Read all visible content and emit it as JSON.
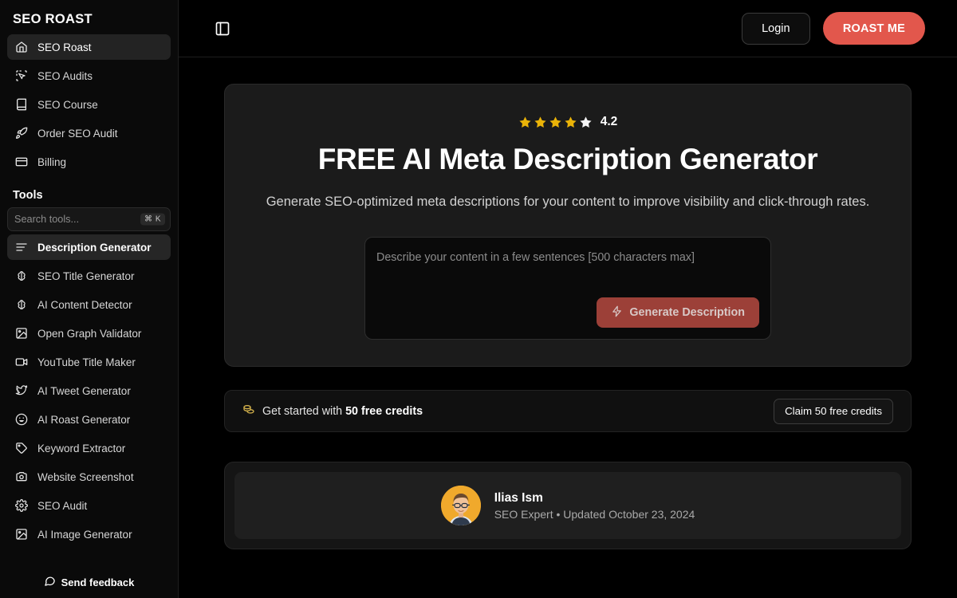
{
  "sidebar": {
    "brand": "SEO ROAST",
    "nav": [
      {
        "label": "SEO Roast",
        "icon": "home-icon",
        "active": true
      },
      {
        "label": "SEO Audits",
        "icon": "cursor-icon",
        "active": false
      },
      {
        "label": "SEO Course",
        "icon": "book-icon",
        "active": false
      },
      {
        "label": "Order SEO Audit",
        "icon": "rocket-icon",
        "active": false
      },
      {
        "label": "Billing",
        "icon": "card-icon",
        "active": false
      }
    ],
    "tools_label": "Tools",
    "search": {
      "placeholder": "Search tools...",
      "value": "",
      "shortcut": "⌘ K"
    },
    "tools": [
      {
        "label": "Description Generator",
        "icon": "lines-icon",
        "active": true
      },
      {
        "label": "SEO Title Generator",
        "icon": "brain-icon",
        "active": false
      },
      {
        "label": "AI Content Detector",
        "icon": "brain-icon",
        "active": false
      },
      {
        "label": "Open Graph Validator",
        "icon": "image-icon",
        "active": false
      },
      {
        "label": "YouTube Title Maker",
        "icon": "video-icon",
        "active": false
      },
      {
        "label": "AI Tweet Generator",
        "icon": "twitter-icon",
        "active": false
      },
      {
        "label": "AI Roast Generator",
        "icon": "smile-icon",
        "active": false
      },
      {
        "label": "Keyword Extractor",
        "icon": "tag-icon",
        "active": false
      },
      {
        "label": "Website Screenshot",
        "icon": "camera-icon",
        "active": false
      },
      {
        "label": "SEO Audit",
        "icon": "gear-icon",
        "active": false
      },
      {
        "label": "AI Image Generator",
        "icon": "image-icon",
        "active": false
      }
    ],
    "feedback": "Send feedback"
  },
  "topbar": {
    "panel_toggle_icon": "sidebar-toggle-icon",
    "login_label": "Login",
    "roast_label": "ROAST ME"
  },
  "hero": {
    "rating_value": "4.2",
    "stars_filled": 4,
    "stars_total": 5,
    "title": "FREE AI Meta Description Generator",
    "subtitle": "Generate SEO-optimized meta descriptions for your content to improve visibility and click-through rates.",
    "textarea": {
      "placeholder": "Describe your content in a few sentences [500 characters max]",
      "value": ""
    },
    "generate_label": "Generate Description",
    "generate_icon": "bolt-icon"
  },
  "credits": {
    "icon": "coins-icon",
    "text_prefix": "Get started with ",
    "amount": "50 free credits",
    "claim_label": "Claim 50 free credits"
  },
  "author": {
    "avatar_icon": "avatar-photo",
    "name": "Ilias Ism",
    "meta": "SEO Expert • Updated October 23, 2024"
  },
  "colors": {
    "accent_red": "#e2574c",
    "generate_red": "#9c4038",
    "star_gold": "#eab308",
    "star_empty": "#f4f4f5",
    "avatar_bg": "#f0a92c",
    "page_bg": "#000000",
    "card_bg": "#1b1b1b"
  }
}
